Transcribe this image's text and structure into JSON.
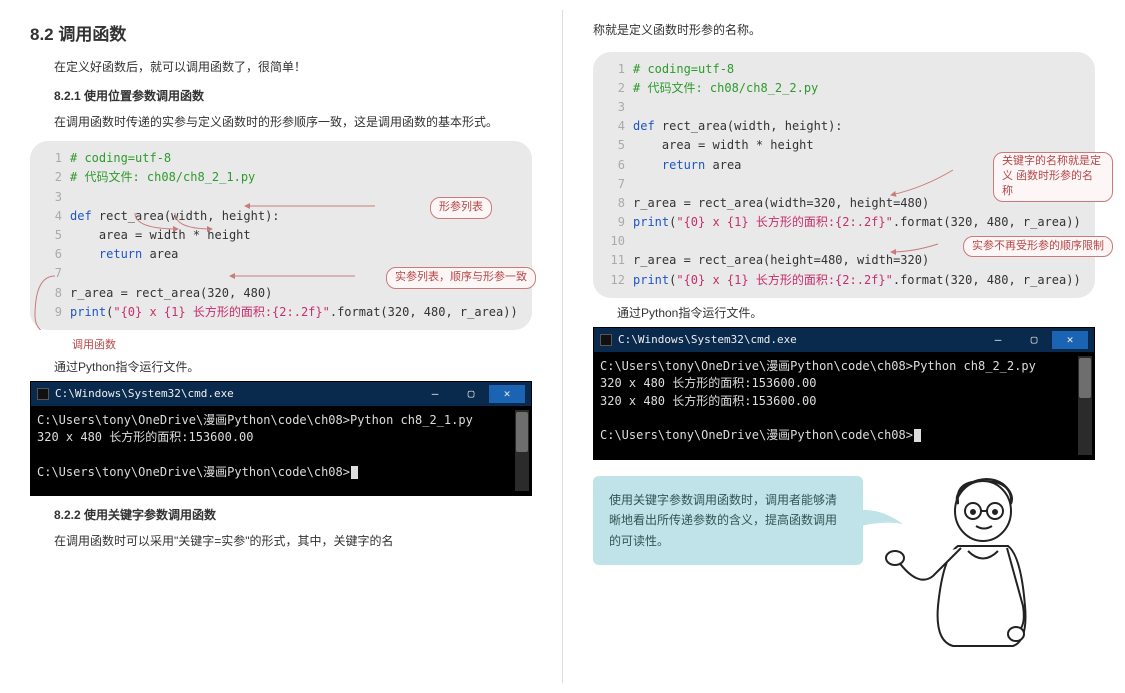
{
  "left": {
    "heading": "8.2 调用函数",
    "intro": "在定义好函数后，就可以调用函数了，很简单！",
    "sub1": "8.2.1 使用位置参数调用函数",
    "sub1_text": "在调用函数时传递的实参与定义函数时的形参顺序一致，这是调用函数的基本形式。",
    "code1": {
      "l1": "# coding=utf-8",
      "l2": "# 代码文件: ch08/ch8_2_1.py",
      "l3": "",
      "l4a": "def",
      "l4b": " rect_area(width, height):",
      "l5": "    area = width * height",
      "l6a": "    ",
      "l6b": "return",
      "l6c": " area",
      "l7": "",
      "l8": "r_area = rect_area(320, 480)",
      "l9a": "print",
      "l9b": "(",
      "l9c": "\"{0} x {1} 长方形的面积:{2:.2f}\"",
      "l9d": ".format(320, 480, r_area))"
    },
    "annot1_1": "形参列表",
    "annot1_2": "实参列表，顺序与形参一致",
    "call_label": "调用函数",
    "run1": "通过Python指令运行文件。",
    "term1": {
      "title": "C:\\Windows\\System32\\cmd.exe",
      "line1": "C:\\Users\\tony\\OneDrive\\漫画Python\\code\\ch08>Python ch8_2_1.py",
      "line2": "320 x 480 长方形的面积:153600.00",
      "line3": "",
      "line4": "C:\\Users\\tony\\OneDrive\\漫画Python\\code\\ch08>"
    },
    "sub2": "8.2.2 使用关键字参数调用函数",
    "sub2_text": "在调用函数时可以采用\"关键字=实参\"的形式，其中，关键字的名"
  },
  "right": {
    "cont": "称就是定义函数时形参的名称。",
    "code2": {
      "l1": "# coding=utf-8",
      "l2": "# 代码文件: ch08/ch8_2_2.py",
      "l3": "",
      "l4a": "def",
      "l4b": " rect_area(width, height):",
      "l5": "    area = width * height",
      "l6a": "    ",
      "l6b": "return",
      "l6c": " area",
      "l7": "",
      "l8": "r_area = rect_area(width=320, height=480)",
      "l9a": "print",
      "l9b": "(",
      "l9c": "\"{0} x {1} 长方形的面积:{2:.2f}\"",
      "l9d": ".format(320, 480, r_area))",
      "l10": "",
      "l11": "r_area = rect_area(height=480, width=320)",
      "l12a": "print",
      "l12b": "(",
      "l12c": "\"{0} x {1} 长方形的面积:{2:.2f}\"",
      "l12d": ".format(320, 480, r_area))"
    },
    "annot2_1": "关键字的名称就是定义\n函数时形参的名称",
    "annot2_2": "实参不再受形参的顺序限制",
    "run2": "通过Python指令运行文件。",
    "term2": {
      "title": "C:\\Windows\\System32\\cmd.exe",
      "line1": "C:\\Users\\tony\\OneDrive\\漫画Python\\code\\ch08>Python ch8_2_2.py",
      "line2": "320 x 480 长方形的面积:153600.00",
      "line3": "320 x 480 长方形的面积:153600.00",
      "line4": "",
      "line5": "C:\\Users\\tony\\OneDrive\\漫画Python\\code\\ch08>"
    },
    "speech": "使用关键字参数调用函数时，调用者能够清晰地看出所传递参数的含义，提高函数调用的可读性。"
  },
  "win": {
    "min": "—",
    "max": "▢",
    "close": "✕"
  }
}
